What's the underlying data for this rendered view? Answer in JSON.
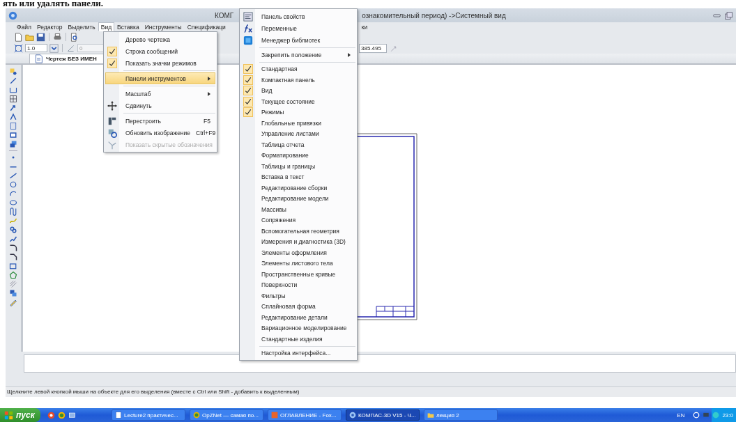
{
  "caption": "ять или удалять панели.",
  "window": {
    "title_left": "КОМГ",
    "title_right": "ознакомительный период) ->Системный вид"
  },
  "menubar": [
    {
      "label": "Файл",
      "selected": false
    },
    {
      "label": "Редактор",
      "selected": false
    },
    {
      "label": "Выделить",
      "selected": false
    },
    {
      "label": "Вид",
      "selected": true
    },
    {
      "label": "Вставка",
      "selected": false
    },
    {
      "label": "Инструменты",
      "selected": false
    },
    {
      "label": "Спецификаци",
      "selected": false
    },
    {
      "label": "ки",
      "selected": false
    }
  ],
  "toolbar": {
    "scale": "1.0",
    "angle": "0",
    "coordinate": "385.495"
  },
  "document_tab": {
    "title": "Чертеж БЕЗ ИМЕН"
  },
  "view_menu": {
    "items": [
      {
        "kind": "item",
        "label": "Дерево чертежа",
        "checked": false,
        "submenu": false,
        "disabled": false,
        "selected": false
      },
      {
        "kind": "item",
        "label": "Строка сообщений",
        "checked": true,
        "submenu": false,
        "disabled": false,
        "selected": false
      },
      {
        "kind": "item",
        "label": "Показать значки режимов",
        "checked": true,
        "submenu": false,
        "disabled": false,
        "selected": false
      },
      {
        "kind": "separator"
      },
      {
        "kind": "item",
        "label": "Панели инструментов",
        "checked": false,
        "submenu": true,
        "disabled": false,
        "selected": true
      },
      {
        "kind": "separator"
      },
      {
        "kind": "item",
        "label": "Масштаб",
        "checked": false,
        "submenu": true,
        "disabled": false,
        "selected": false
      },
      {
        "kind": "item",
        "label": "Сдвинуть",
        "checked": false,
        "submenu": false,
        "disabled": false,
        "selected": false
      },
      {
        "kind": "separator"
      },
      {
        "kind": "item",
        "label": "Перестроить",
        "shortcut": "F5",
        "checked": false,
        "submenu": false,
        "disabled": false,
        "selected": false
      },
      {
        "kind": "item",
        "label": "Обновить изображение",
        "shortcut": "Ctrl+F9",
        "checked": false,
        "submenu": false,
        "disabled": false,
        "selected": false
      },
      {
        "kind": "item",
        "label": "Показать скрытые обозначения",
        "checked": false,
        "submenu": false,
        "disabled": true,
        "selected": false
      }
    ]
  },
  "toolbars_submenu": {
    "items": [
      {
        "kind": "item",
        "label": "Панель свойств",
        "checked": false,
        "submenu": false,
        "selected": false
      },
      {
        "kind": "item",
        "label": "Переменные",
        "checked": false,
        "submenu": false,
        "selected": false
      },
      {
        "kind": "item",
        "label": "Менеджер библиотек",
        "checked": false,
        "submenu": false,
        "selected": false
      },
      {
        "kind": "separator"
      },
      {
        "kind": "item",
        "label": "Закрепить положение",
        "checked": false,
        "submenu": true,
        "selected": false
      },
      {
        "kind": "separator"
      },
      {
        "kind": "item",
        "label": "Стандартная",
        "checked": true,
        "submenu": false,
        "selected": false
      },
      {
        "kind": "item",
        "label": "Компактная панель",
        "checked": true,
        "submenu": false,
        "selected": false
      },
      {
        "kind": "item",
        "label": "Вид",
        "checked": true,
        "submenu": false,
        "selected": false
      },
      {
        "kind": "item",
        "label": "Текущее состояние",
        "checked": true,
        "submenu": false,
        "selected": false
      },
      {
        "kind": "item",
        "label": "Режимы",
        "checked": true,
        "submenu": false,
        "selected": false
      },
      {
        "kind": "item",
        "label": "Глобальные привязки",
        "checked": false,
        "submenu": false,
        "selected": false
      },
      {
        "kind": "item",
        "label": "Управление листами",
        "checked": false,
        "submenu": false,
        "selected": false
      },
      {
        "kind": "item",
        "label": "Таблица отчета",
        "checked": false,
        "submenu": false,
        "selected": false
      },
      {
        "kind": "item",
        "label": "Форматирование",
        "checked": false,
        "submenu": false,
        "selected": false
      },
      {
        "kind": "item",
        "label": "Таблицы и границы",
        "checked": false,
        "submenu": false,
        "selected": false
      },
      {
        "kind": "item",
        "label": "Вставка в текст",
        "checked": false,
        "submenu": false,
        "selected": false
      },
      {
        "kind": "item",
        "label": "Редактирование сборки",
        "checked": false,
        "submenu": false,
        "selected": false
      },
      {
        "kind": "item",
        "label": "Редактирование модели",
        "checked": false,
        "submenu": false,
        "selected": false
      },
      {
        "kind": "item",
        "label": "Массивы",
        "checked": false,
        "submenu": false,
        "selected": false
      },
      {
        "kind": "item",
        "label": "Сопряжения",
        "checked": false,
        "submenu": false,
        "selected": false
      },
      {
        "kind": "item",
        "label": "Вспомогательная геометрия",
        "checked": false,
        "submenu": false,
        "selected": false
      },
      {
        "kind": "item",
        "label": "Измерения и диагностика (3D)",
        "checked": false,
        "submenu": false,
        "selected": false
      },
      {
        "kind": "item",
        "label": "Элементы оформления",
        "checked": false,
        "submenu": false,
        "selected": false
      },
      {
        "kind": "item",
        "label": "Элементы листового тела",
        "checked": false,
        "submenu": false,
        "selected": false
      },
      {
        "kind": "item",
        "label": "Пространственные кривые",
        "checked": false,
        "submenu": false,
        "selected": false
      },
      {
        "kind": "item",
        "label": "Поверхности",
        "checked": false,
        "submenu": false,
        "selected": false
      },
      {
        "kind": "item",
        "label": "Фильтры",
        "checked": false,
        "submenu": false,
        "selected": false
      },
      {
        "kind": "item",
        "label": "Сплайновая форма",
        "checked": false,
        "submenu": false,
        "selected": false
      },
      {
        "kind": "item",
        "label": "Редактирование детали",
        "checked": false,
        "submenu": false,
        "selected": false
      },
      {
        "kind": "item",
        "label": "Вариационное моделирование",
        "checked": false,
        "submenu": false,
        "selected": false
      },
      {
        "kind": "item",
        "label": "Стандартные изделия",
        "checked": false,
        "submenu": false,
        "selected": false
      },
      {
        "kind": "separator"
      },
      {
        "kind": "item",
        "label": "Настройка интерфейса...",
        "checked": false,
        "submenu": false,
        "selected": false
      }
    ]
  },
  "status_bar": {
    "message": "Щелкните левой кнопкой мыши на объекте для его выделения (вместе с Ctrl или Shift - добавить к выделенным)"
  },
  "taskbar": {
    "start": "пуск",
    "tasks": [
      {
        "label": "Lecture2 практичес...",
        "selected": false
      },
      {
        "label": "OpZNet — самая по...",
        "selected": false
      },
      {
        "label": "ОГЛАВЛЕНИЕ - Fox...",
        "selected": false
      },
      {
        "label": "КОМПАС-3D V15 - Ч...",
        "selected": true
      },
      {
        "label": "лекция 2",
        "selected": false
      }
    ],
    "language": "EN",
    "clock": "23:0"
  }
}
